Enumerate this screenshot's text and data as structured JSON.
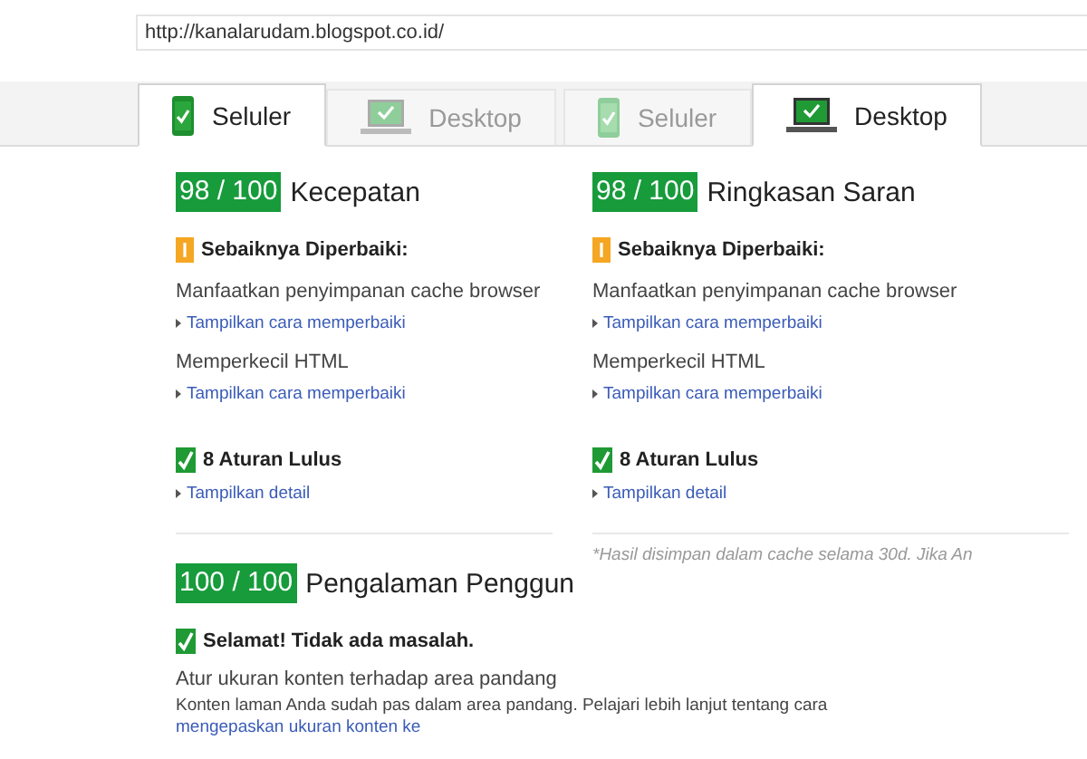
{
  "url_field": {
    "value": "http://kanalarudam.blogspot.co.id/"
  },
  "tab_groups": [
    {
      "tabs": [
        {
          "label": "Seluler",
          "kind": "phone",
          "selected": true
        },
        {
          "label": "Desktop",
          "kind": "laptop",
          "selected": false
        }
      ]
    },
    {
      "tabs": [
        {
          "label": "Seluler",
          "kind": "phone",
          "selected": false
        },
        {
          "label": "Desktop",
          "kind": "laptop",
          "selected": true
        }
      ]
    }
  ],
  "panels": [
    {
      "score": "98 / 100",
      "title": "Kecepatan",
      "groups": [
        {
          "kind": "warning",
          "heading": "Sebaiknya Diperbaiki:",
          "rules": [
            {
              "name": "Manfaatkan penyimpanan cache browser",
              "link": "Tampilkan cara memperbaiki"
            },
            {
              "name": "Memperkecil HTML",
              "link": "Tampilkan cara memperbaiki"
            }
          ]
        },
        {
          "kind": "pass",
          "heading": "8 Aturan Lulus",
          "link": "Tampilkan detail"
        }
      ]
    },
    {
      "score": "98 / 100",
      "title": "Ringkasan Saran",
      "groups": [
        {
          "kind": "warning",
          "heading": "Sebaiknya Diperbaiki:",
          "rules": [
            {
              "name": "Manfaatkan penyimpanan cache browser",
              "link": "Tampilkan cara memperbaiki"
            },
            {
              "name": "Memperkecil HTML",
              "link": "Tampilkan cara memperbaiki"
            }
          ]
        },
        {
          "kind": "pass",
          "heading": "8 Aturan Lulus",
          "link": "Tampilkan detail"
        }
      ]
    }
  ],
  "ux_section": {
    "score": "100 / 100",
    "title": "Pengalaman Penggun",
    "group": {
      "kind": "pass",
      "heading": "Selamat! Tidak ada masalah.",
      "rules": [
        {
          "name": "Atur ukuran konten terhadap area pandang",
          "description": "Konten laman Anda sudah pas dalam area pandang. Pelajari lebih lanjut tentang cara",
          "description_link": "mengepaskan ukuran konten ke"
        }
      ]
    }
  },
  "cache_note": "*Hasil disimpan dalam cache selama 30d. Jika An"
}
